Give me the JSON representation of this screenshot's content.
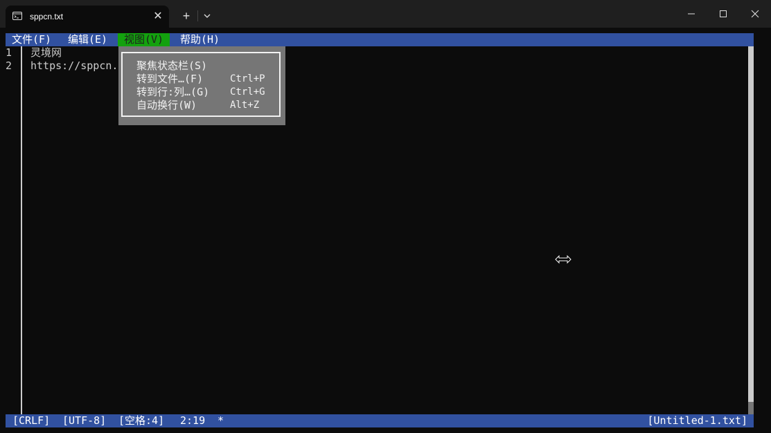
{
  "window": {
    "tab_title": "sppcn.txt",
    "tab_close": "✕",
    "new_tab": "+"
  },
  "menubar": {
    "items": [
      {
        "label": "文件(F)"
      },
      {
        "label": "编辑(E)"
      },
      {
        "label": "视图(V)",
        "active": true
      },
      {
        "label": "帮助(H)"
      }
    ]
  },
  "editor": {
    "lines": [
      {
        "number": "1",
        "text": "灵境网"
      },
      {
        "number": "2",
        "text": "https://sppcn."
      }
    ]
  },
  "view_menu": {
    "items": [
      {
        "label": "聚焦状态栏(S)",
        "shortcut": ""
      },
      {
        "label": "转到文件…(F)",
        "shortcut": "Ctrl+P"
      },
      {
        "label": "转到行:列…(G)",
        "shortcut": "Ctrl+G"
      },
      {
        "label": "自动换行(W)",
        "shortcut": "Alt+Z"
      }
    ]
  },
  "statusbar": {
    "line_ending": "[CRLF]",
    "encoding": "[UTF-8]",
    "indent": "[空格:4]",
    "position": "2:19",
    "modified": "*",
    "filename": "[Untitled-1.txt]"
  },
  "colors": {
    "menubar_bg": "#3151a0",
    "menu_active_bg": "#13a10e",
    "dropdown_bg": "#767676",
    "editor_bg": "#0c0c0c",
    "titlebar_bg": "#1f1f1f"
  }
}
